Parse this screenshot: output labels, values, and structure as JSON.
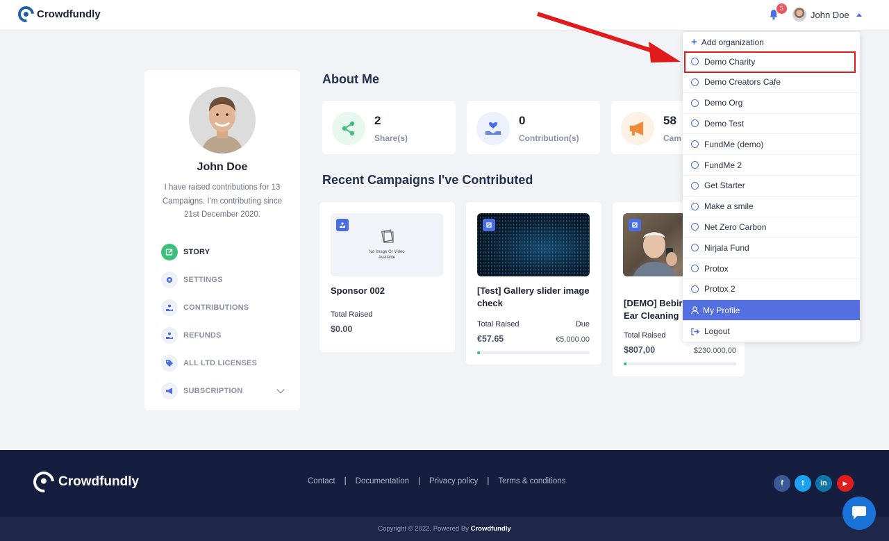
{
  "header": {
    "brand": "Crowdfundly",
    "notification_count": "5",
    "user_name": "John Doe"
  },
  "profile": {
    "name": "John Doe",
    "bio": "I have raised contributions for 13 Campaigns. I'm contributing since 21st December 2020.",
    "menu": [
      {
        "label": "STORY",
        "icon": "edit-icon"
      },
      {
        "label": "SETTINGS",
        "icon": "gear-icon"
      },
      {
        "label": "CONTRIBUTIONS",
        "icon": "hand-coin-icon"
      },
      {
        "label": "REFUNDS",
        "icon": "hand-refund-icon"
      },
      {
        "label": "ALL LTD LICENSES",
        "icon": "tag-icon"
      },
      {
        "label": "SUBSCRIPTION",
        "icon": "megaphone-icon"
      }
    ]
  },
  "about": {
    "title": "About Me",
    "stats": [
      {
        "value": "2",
        "label": "Share(s)",
        "icon": "share-icon",
        "color": "#3cbf7d"
      },
      {
        "value": "0",
        "label": "Contribution(s)",
        "icon": "heart-hand-icon",
        "color": "#4a6ee0"
      },
      {
        "value": "58",
        "label": "Cam",
        "icon": "megaphone-icon",
        "color": "#f08a35"
      }
    ]
  },
  "campaigns": {
    "title": "Recent Campaigns I've Contributed",
    "placeholder_text": "No Image Or Video Available",
    "items": [
      {
        "title": "Sponsor 002",
        "raised_label": "Total Raised",
        "raised": "$0.00",
        "due_label": "",
        "goal": "",
        "progress": 0
      },
      {
        "title": "[Test] Gallery slider image check",
        "raised_label": "Total Raised",
        "raised": "€57.65",
        "due_label": "Due",
        "goal": "€5,000.00",
        "progress": 0.0115
      },
      {
        "title": "[DEMO] Bebir Ear Cleaning",
        "raised_label": "Total Raised",
        "raised": "$807,00",
        "due_label": "",
        "goal": "$230.000,00",
        "progress": 0.0035
      }
    ]
  },
  "dropdown": {
    "add_label": "Add organization",
    "orgs": [
      "Demo Charity",
      "Demo Creators Cafe",
      "Demo Org",
      "Demo Test",
      "FundMe (demo)",
      "FundMe 2",
      "Get Starter",
      "Make a smile",
      "Net Zero Carbon",
      "Nirjala Fund",
      "Protox",
      "Protox 2"
    ],
    "my_profile": "My Profile",
    "logout": "Logout"
  },
  "footer": {
    "brand": "Crowdfundly",
    "links": [
      "Contact",
      "Documentation",
      "Privacy policy",
      "Terms & conditions"
    ],
    "social": [
      {
        "name": "facebook-icon",
        "glyph": "f",
        "color": "#3b5998"
      },
      {
        "name": "twitter-icon",
        "glyph": "t",
        "color": "#1da1f2"
      },
      {
        "name": "linkedin-icon",
        "glyph": "in",
        "color": "#0e76a8"
      },
      {
        "name": "youtube-icon",
        "glyph": "▶",
        "color": "#e21d1d"
      }
    ],
    "copyright_prefix": "Copyright © 2022. Powered By ",
    "copyright_brand": "Crowdfundly"
  },
  "colors": {
    "accent": "#4a6ee0",
    "success": "#3cbf7d",
    "highlight": "#e11b1b"
  }
}
